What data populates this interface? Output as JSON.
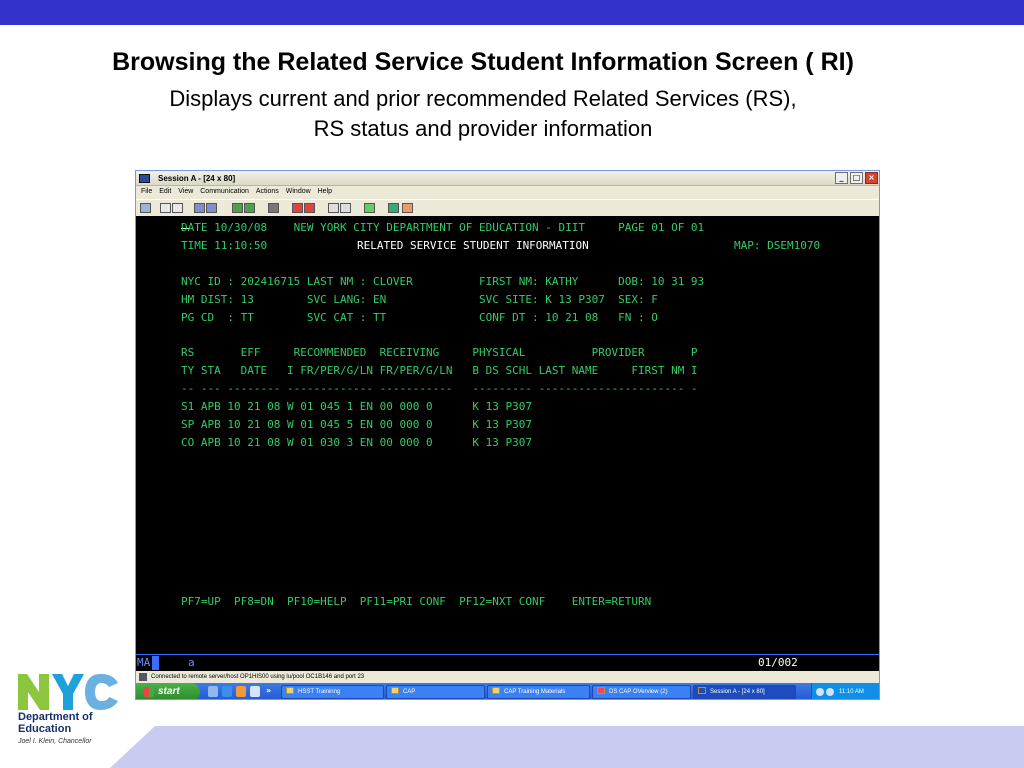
{
  "slide": {
    "title": "Browsing the Related Service Student Information Screen ( RI)",
    "subtitle_1": "Displays current and prior recommended Related Services (RS),",
    "subtitle_2": "RS status and provider information",
    "accent_color": "#3333cc",
    "lower_band_color": "#c9cbf0"
  },
  "window": {
    "title": "Session A - [24 x 80]",
    "controls": [
      "minimize",
      "maximize",
      "close"
    ],
    "menu": [
      "File",
      "Edit",
      "View",
      "Communication",
      "Actions",
      "Window",
      "Help"
    ]
  },
  "terminal": {
    "lines": [
      "DATE 10/30/08    NEW YORK CITY DEPARTMENT OF EDUCATION - DIIT     PAGE 01 OF 01",
      "TIME 11:10:50",
      "",
      "NYC ID : 202416715 LAST NM : CLOVER          FIRST NM: KATHY      DOB: 10 31 93",
      "HM DIST: 13        SVC LANG: EN              SVC SITE: K 13 P307  SEX: F",
      "PG CD  : TT        SVC CAT : TT              CONF DT : 10 21 08   FN : O",
      "",
      "RS       EFF     RECOMMENDED  RECEIVING     PHYSICAL          PROVIDER       P",
      "TY STA   DATE   I FR/PER/G/LN FR/PER/G/LN   B DS SCHL LAST NAME     FIRST NM I",
      "-- --- -------- ------------- -----------   --------- ---------------------- -",
      "S1 APB 10 21 08 W 01 045 1 EN 00 000 0      K 13 P307",
      "SP APB 10 21 08 W 01 045 5 EN 00 000 0      K 13 P307",
      "CO APB 10 21 08 W 01 030 3 EN 00 000 0      K 13 P307",
      "",
      "",
      "",
      "",
      "",
      "",
      "",
      "",
      "PF7=UP  PF8=DN  PF10=HELP  PF11=PRI CONF  PF12=NXT CONF    ENTER=RETURN"
    ],
    "screen_title": "RELATED SERVICE STUDENT INFORMATION",
    "map_label": "MAP: DSEM1070",
    "oia_mode": "MA",
    "oia_indicator": "a",
    "cursor_position": "01/002",
    "text_color": "#33cc66"
  },
  "statusbar": {
    "text": "Connected to remote server/host OP1HIS00 using lu/pool OC1B146 and port 23"
  },
  "taskbar": {
    "start_label": "start",
    "tasks": [
      {
        "label": "HSST Traininng",
        "active": false
      },
      {
        "label": "CAP",
        "active": false
      },
      {
        "label": "CAP Training Materials",
        "active": false
      },
      {
        "label": "DS CAP OVerview (2)",
        "active": false
      },
      {
        "label": "Session A - [24 x 80]",
        "active": true
      }
    ],
    "clock": "11:10 AM"
  },
  "logo": {
    "wordmark": "NYC",
    "org_line_1": "Department of",
    "org_line_2": "Education",
    "chancellor": "Joel I. Klein, Chancellor",
    "colors": [
      "#8cc63f",
      "#1ea0d8",
      "#6ab0e0"
    ]
  }
}
